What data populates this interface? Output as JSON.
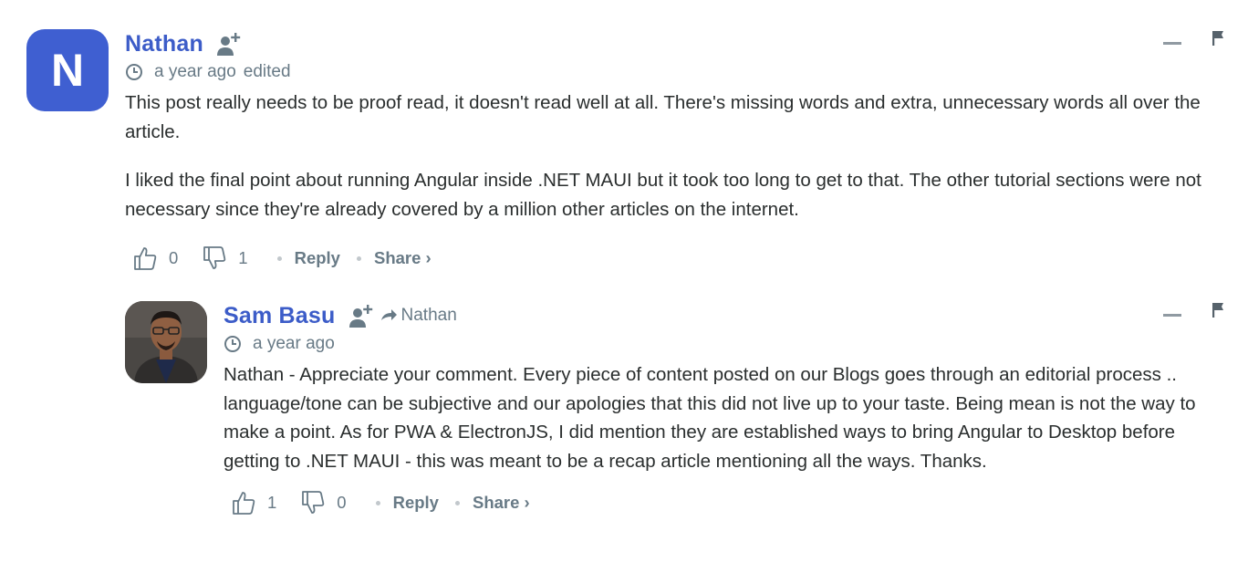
{
  "comments": [
    {
      "avatar_letter": "N",
      "author": "Nathan",
      "time": "a year ago",
      "edited": "edited",
      "paragraphs": [
        "This post really needs to be proof read, it doesn't read well at all. There's missing words and extra, unnecessary words all over the article.",
        "I liked the final point about running Angular inside .NET MAUI but it took too long to get to that. The other tutorial sections were not necessary since they're already covered by a million other articles on the internet."
      ],
      "upvotes": "0",
      "downvotes": "1",
      "reply_label": "Reply",
      "share_label": "Share ›"
    },
    {
      "author": "Sam Basu",
      "reply_to": "Nathan",
      "time": "a year ago",
      "paragraphs": [
        "Nathan - Appreciate your comment. Every piece of content posted on our Blogs goes through an editorial process .. language/tone can be subjective and our apologies that this did not live up to your taste. Being mean is not the way to make a point. As for PWA & ElectronJS, I did mention they are established ways to bring Angular to Desktop before getting to .NET MAUI - this was meant to be a recap article mentioning all the ways. Thanks."
      ],
      "upvotes": "1",
      "downvotes": "0",
      "reply_label": "Reply",
      "share_label": "Share ›"
    }
  ],
  "colors": {
    "author": "#3c5cc8",
    "avatar_bg": "#3f5fd1",
    "meta": "#687a86",
    "text": "#2a2e2e"
  },
  "icons": [
    "follow-icon",
    "clock-icon",
    "minimize-icon",
    "flag-icon",
    "thumbs-up-icon",
    "thumbs-down-icon",
    "reply-arrow-icon"
  ]
}
